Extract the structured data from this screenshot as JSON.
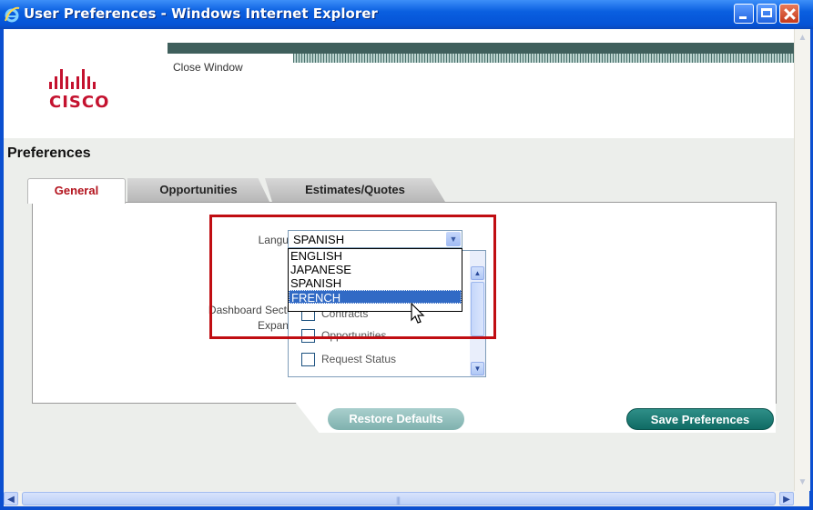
{
  "window": {
    "title": "User Preferences - Windows Internet Explorer"
  },
  "header": {
    "close_link": "Close Window"
  },
  "page": {
    "title": "Preferences"
  },
  "tabs": [
    {
      "label": "General",
      "active": true
    },
    {
      "label": "Opportunities",
      "active": false
    },
    {
      "label": "Estimates/Quotes",
      "active": false
    }
  ],
  "form": {
    "language_label": "Language",
    "language_value": "SPANISH",
    "language_options": [
      "ENGLISH",
      "JAPANESE",
      "SPANISH",
      "FRENCH"
    ],
    "highlighted_option": "FRENCH",
    "dashboard_label_line1": "Dashboard Sections",
    "dashboard_label_line2": "Expanded",
    "dashboard_sections": [
      "Contracts",
      "Opportunities",
      "Request Status"
    ]
  },
  "buttons": {
    "restore": "Restore Defaults",
    "save": "Save Preferences"
  },
  "colors": {
    "titlebar": "#0553d6",
    "brand_red": "#c4122f",
    "highlight_red": "#c00d12",
    "button_teal": "#0f6b64",
    "selection_blue": "#316ac5"
  }
}
